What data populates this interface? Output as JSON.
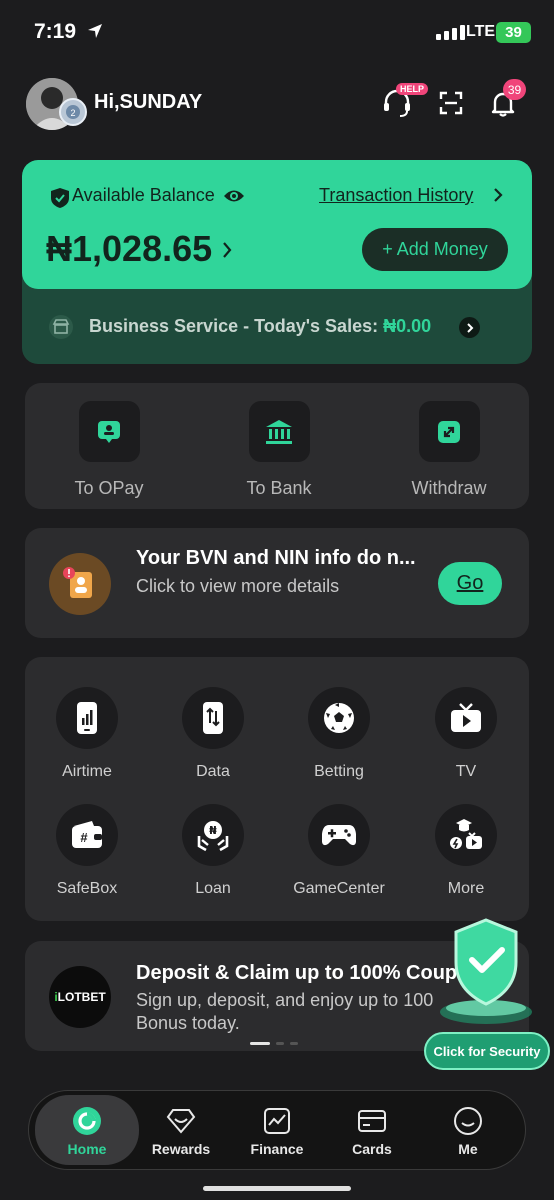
{
  "status_bar": {
    "time": "7:19",
    "network": "LTE",
    "battery": "39"
  },
  "header": {
    "greeting": "Hi,SUNDAY",
    "help_tag": "HELP",
    "notification_count": "39"
  },
  "balance": {
    "label": "Available Balance",
    "history_link": "Transaction History",
    "amount": "₦1,028.65",
    "add_money": "+ Add Money",
    "business_label": "Business Service - Today's Sales:",
    "business_amount": "₦0.00"
  },
  "transfers": [
    {
      "label": "To OPay",
      "icon": "person-card-icon"
    },
    {
      "label": "To Bank",
      "icon": "bank-icon"
    },
    {
      "label": "Withdraw",
      "icon": "withdraw-icon"
    }
  ],
  "notice": {
    "title": "Your BVN and NIN info do n...",
    "subtitle": "Click to view more details",
    "button": "Go"
  },
  "services": [
    {
      "label": "Airtime",
      "icon": "phone-signal-icon"
    },
    {
      "label": "Data",
      "icon": "data-transfer-icon"
    },
    {
      "label": "Betting",
      "icon": "football-icon"
    },
    {
      "label": "TV",
      "icon": "tv-icon"
    },
    {
      "label": "SafeBox",
      "icon": "wallet-icon"
    },
    {
      "label": "Loan",
      "icon": "loan-hands-icon"
    },
    {
      "label": "GameCenter",
      "icon": "gamepad-icon"
    },
    {
      "label": "More",
      "icon": "more-icon"
    }
  ],
  "promo": {
    "logo_i": "i",
    "logo_rest": "LOTBET",
    "title": "Deposit & Claim up to 100% Coup",
    "subtitle": "Sign up, deposit, and enjoy up to 100 Bonus today."
  },
  "security": {
    "label": "Click for Security"
  },
  "tabs": [
    {
      "label": "Home",
      "active": true
    },
    {
      "label": "Rewards"
    },
    {
      "label": "Finance"
    },
    {
      "label": "Cards"
    },
    {
      "label": "Me"
    }
  ],
  "colors": {
    "accent": "#30d59a",
    "background": "#1c1c1e",
    "panel": "#2c2c2e",
    "badge": "#f0457a"
  }
}
